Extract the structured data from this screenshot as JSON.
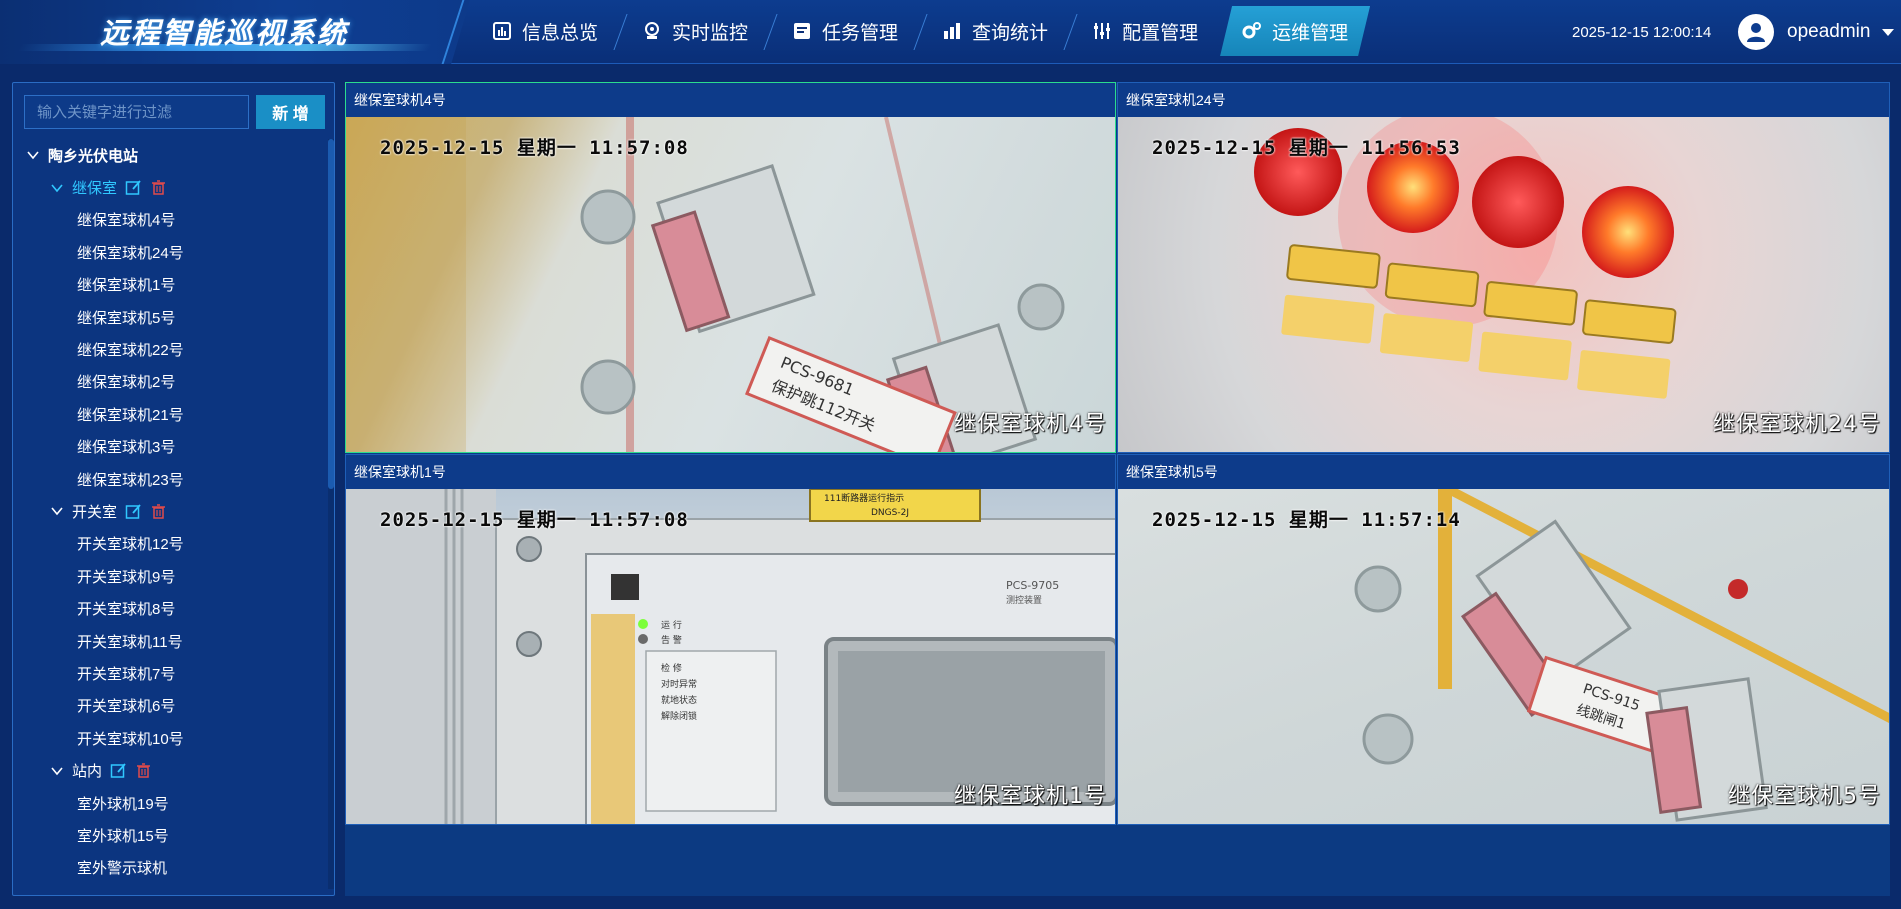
{
  "app": {
    "title": "远程智能巡视系统"
  },
  "nav": {
    "items": [
      {
        "label": "信息总览",
        "icon": "bar-chart-icon"
      },
      {
        "label": "实时监控",
        "icon": "webcam-icon"
      },
      {
        "label": "任务管理",
        "icon": "task-icon"
      },
      {
        "label": "查询统计",
        "icon": "stats-icon"
      },
      {
        "label": "配置管理",
        "icon": "sliders-icon"
      },
      {
        "label": "运维管理",
        "icon": "gears-icon",
        "active": true
      }
    ]
  },
  "header": {
    "datetime": "2025-12-15 12:00:14",
    "username": "opeadmin"
  },
  "sidebar": {
    "search": {
      "placeholder": "输入关键字进行过滤",
      "value": ""
    },
    "add_label": "新 增",
    "tree": {
      "root": "陶乡光伏电站",
      "groups": [
        {
          "label": "继保室",
          "active": true,
          "items": [
            "继保室球机4号",
            "继保室球机24号",
            "继保室球机1号",
            "继保室球机5号",
            "继保室球机22号",
            "继保室球机2号",
            "继保室球机21号",
            "继保室球机3号",
            "继保室球机23号"
          ]
        },
        {
          "label": "开关室",
          "items": [
            "开关室球机12号",
            "开关室球机9号",
            "开关室球机8号",
            "开关室球机11号",
            "开关室球机7号",
            "开关室球机6号",
            "开关室球机10号"
          ]
        },
        {
          "label": "站内",
          "items": [
            "室外球机19号",
            "室外球机15号",
            "室外警示球机"
          ]
        }
      ]
    }
  },
  "videos": [
    {
      "title": "继保室球机4号",
      "osd_time": "2025-12-15  星期一  11:57:08",
      "osd_name": "继保室球机4号",
      "label1": "PCS-9681",
      "label2": "保护跳112开关"
    },
    {
      "title": "继保室球机24号",
      "osd_time": "2025-12-15  星期一  11:56:53",
      "osd_name": "继保室球机24号"
    },
    {
      "title": "继保室球机1号",
      "osd_time": "2025-12-15  星期一  11:57:08",
      "osd_name": "继保室球机1号",
      "device": "PCS-9705",
      "device_sub": "测控装置",
      "status_run": "运  行",
      "status_alarm": "告  警",
      "lines": [
        "检  修",
        "对时异常",
        "就地状态",
        "解除闭锁"
      ],
      "top_label": "DNGS-2J",
      "top_text": "111断路器运行指示"
    },
    {
      "title": "继保室球机5号",
      "osd_time": "2025-12-15  星期一  11:57:14",
      "osd_name": "继保室球机5号",
      "label1": "PCS-915",
      "label2": "线跳闸1"
    }
  ],
  "toolbar": {
    "single_view": "single-view-icon",
    "split_view": "split-view-icon",
    "close": "close-icon"
  },
  "colors": {
    "accent": "#1a8fc6",
    "nav_active": "#1f93c9",
    "active_text": "#30c8ff",
    "delete": "#e04b4b",
    "edit": "#30c8ff",
    "selected_border": "#2bdc8e"
  }
}
